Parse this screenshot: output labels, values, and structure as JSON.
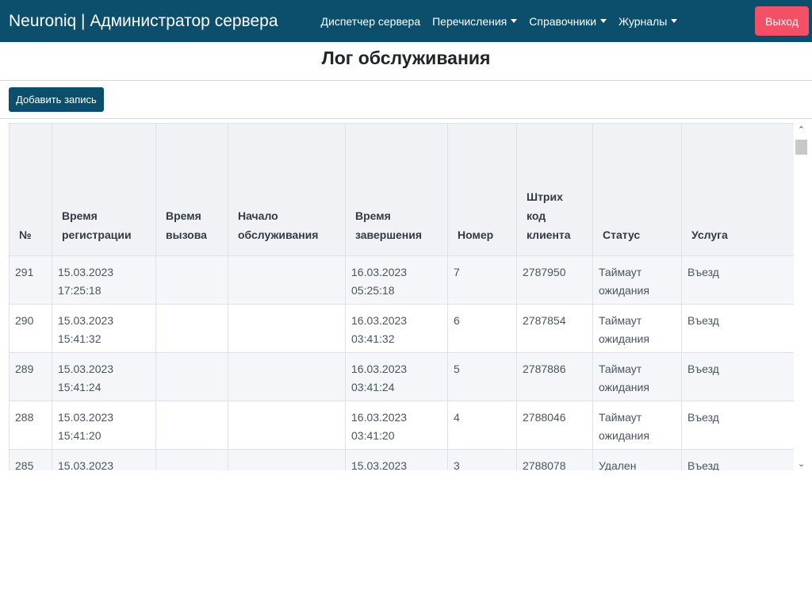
{
  "navbar": {
    "brand": "Neuroniq | Администратор сервера",
    "links": [
      {
        "label": "Диспетчер сервера"
      },
      {
        "label": "Перечисления"
      },
      {
        "label": "Справочники"
      },
      {
        "label": "Журналы"
      }
    ],
    "logout_label": "Выход"
  },
  "page": {
    "title": "Лог обслуживания",
    "add_button_label": "Добавить запись"
  },
  "table": {
    "columns": [
      "№",
      "Время регистрации",
      "Время вызова",
      "Начало обслуживания",
      "Время завершения",
      "Номер",
      "Штрих код клиента",
      "Статус",
      "Услуга"
    ],
    "rows": [
      {
        "id": "291",
        "reg": "15.03.2023 17:25:18",
        "call": "",
        "start": "",
        "end": "16.03.2023 05:25:18",
        "number": "7",
        "barcode": "2787950",
        "status": "Таймаут ожидания",
        "service": "Въезд"
      },
      {
        "id": "290",
        "reg": "15.03.2023 15:41:32",
        "call": "",
        "start": "",
        "end": "16.03.2023 03:41:32",
        "number": "6",
        "barcode": "2787854",
        "status": "Таймаут ожидания",
        "service": "Въезд"
      },
      {
        "id": "289",
        "reg": "15.03.2023 15:41:24",
        "call": "",
        "start": "",
        "end": "16.03.2023 03:41:24",
        "number": "5",
        "barcode": "2787886",
        "status": "Таймаут ожидания",
        "service": "Въезд"
      },
      {
        "id": "288",
        "reg": "15.03.2023 15:41:20",
        "call": "",
        "start": "",
        "end": "16.03.2023 03:41:20",
        "number": "4",
        "barcode": "2788046",
        "status": "Таймаут ожидания",
        "service": "Въезд"
      },
      {
        "id": "285",
        "reg": "15.03.2023",
        "call": "",
        "start": "",
        "end": "15.03.2023",
        "number": "3",
        "barcode": "2788078",
        "status": "Удален",
        "service": "Въезд"
      }
    ]
  },
  "icons": {
    "caret": "caret-down-icon",
    "scroll_up": "chevron-up-icon",
    "scroll_down": "chevron-down-icon"
  },
  "colors": {
    "navbar": "#0b4f6c",
    "logout": "#f25065",
    "add_button": "#0b4f6c"
  }
}
